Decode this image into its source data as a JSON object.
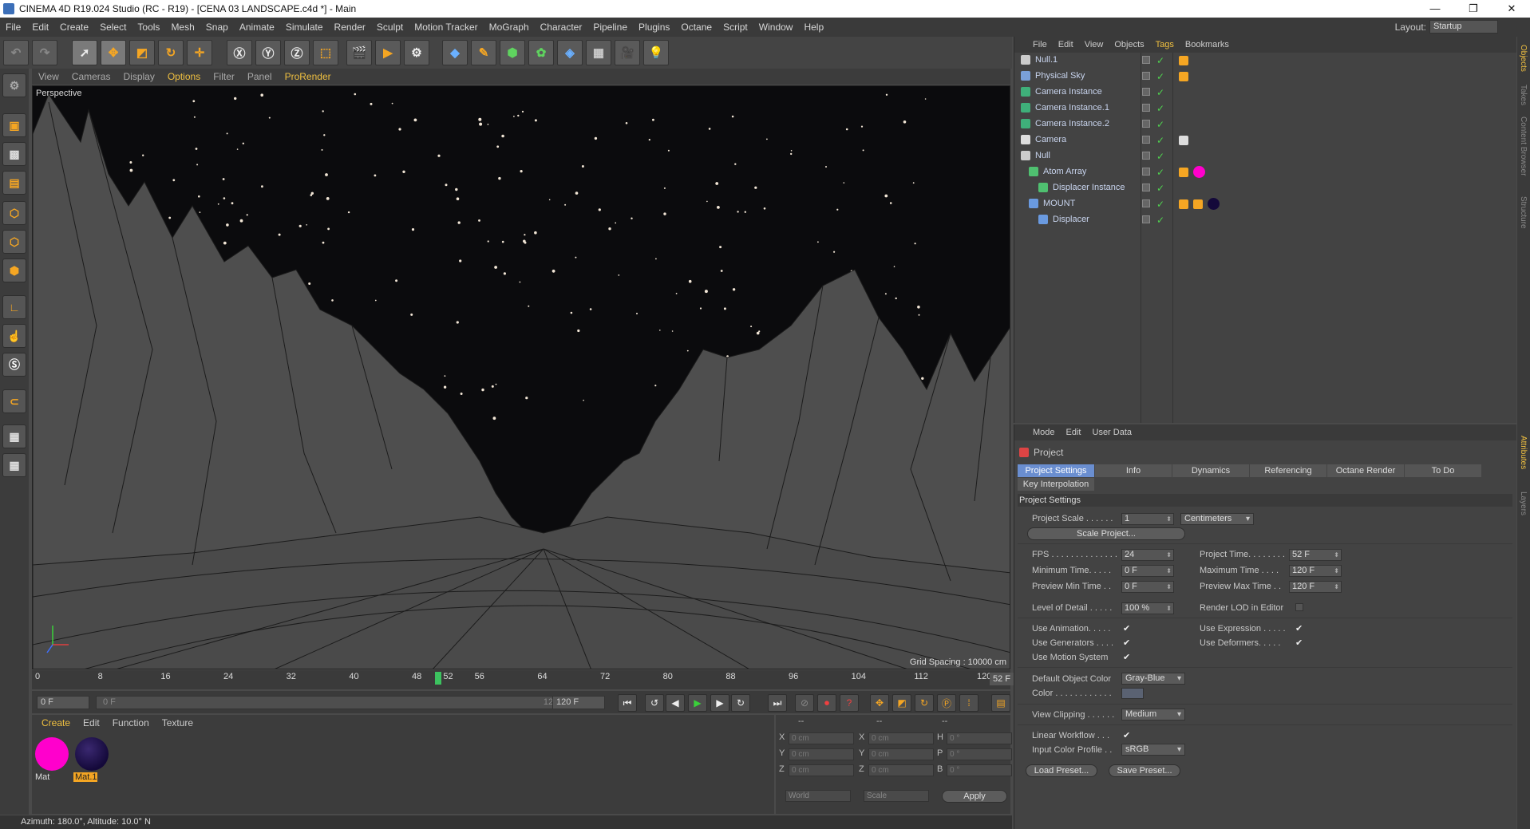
{
  "window": {
    "title": "CINEMA 4D R19.024 Studio (RC - R19) - [CENA 03 LANDSCAPE.c4d *] - Main"
  },
  "menu": [
    "File",
    "Edit",
    "Create",
    "Select",
    "Tools",
    "Mesh",
    "Snap",
    "Animate",
    "Simulate",
    "Render",
    "Sculpt",
    "Motion Tracker",
    "MoGraph",
    "Character",
    "Pipeline",
    "Plugins",
    "Octane",
    "Script",
    "Window",
    "Help"
  ],
  "layout": {
    "label": "Layout:",
    "value": "Startup"
  },
  "viewport": {
    "menu": [
      "View",
      "Cameras",
      "Display",
      "Options",
      "Filter",
      "Panel",
      "ProRender"
    ],
    "label": "Perspective",
    "grid_spacing": "Grid Spacing : 10000 cm"
  },
  "timeline": {
    "ticks": [
      "0",
      "8",
      "16",
      "24",
      "32",
      "40",
      "48",
      "52",
      "56",
      "64",
      "72",
      "80",
      "88",
      "96",
      "104",
      "112",
      "120"
    ],
    "current_frame": "52 F",
    "start": "0 F",
    "range_start": "0 F",
    "range_end": "120 F",
    "end": "120 F"
  },
  "materials": {
    "menu": [
      "Create",
      "Edit",
      "Function",
      "Texture"
    ],
    "items": [
      {
        "name": "Mat",
        "color": "#ff00cc"
      },
      {
        "name": "Mat.1",
        "color": "#14093a"
      }
    ]
  },
  "coords": {
    "headers": [
      "--",
      "--",
      "--"
    ],
    "rows": [
      {
        "a": "X",
        "av": "0 cm",
        "b": "X",
        "bv": "0 cm",
        "c": "H",
        "cv": "0 °"
      },
      {
        "a": "Y",
        "av": "0 cm",
        "b": "Y",
        "bv": "0 cm",
        "c": "P",
        "cv": "0 °"
      },
      {
        "a": "Z",
        "av": "0 cm",
        "b": "Z",
        "bv": "0 cm",
        "c": "B",
        "cv": "0 °"
      }
    ],
    "world": "World",
    "scale": "Scale",
    "apply": "Apply"
  },
  "status": "Azimuth: 180.0°, Altitude: 10.0°  N",
  "objects": {
    "menu": [
      "File",
      "Edit",
      "View",
      "Objects",
      "Tags",
      "Bookmarks"
    ],
    "rows": [
      {
        "name": "Null.1",
        "icon": "null-icon"
      },
      {
        "name": "Physical Sky",
        "icon": "sky-icon"
      },
      {
        "name": "Camera Instance",
        "icon": "camera-instance-icon"
      },
      {
        "name": "Camera Instance.1",
        "icon": "camera-instance-icon"
      },
      {
        "name": "Camera Instance.2",
        "icon": "camera-instance-icon"
      },
      {
        "name": "Camera",
        "icon": "camera-icon"
      },
      {
        "name": "Null",
        "icon": "null-icon"
      },
      {
        "name": "Atom Array",
        "icon": "atom-array-icon"
      },
      {
        "name": "Displacer Instance",
        "icon": "instance-icon"
      },
      {
        "name": "MOUNT",
        "icon": "plane-icon"
      },
      {
        "name": "Displacer",
        "icon": "displacer-icon"
      }
    ]
  },
  "attributes": {
    "menu": [
      "Mode",
      "Edit",
      "User Data"
    ],
    "object": "Project",
    "tabs": [
      "Project Settings",
      "Info",
      "Dynamics",
      "Referencing",
      "Octane Render",
      "To Do",
      "Key Interpolation"
    ],
    "section": "Project Settings",
    "project_scale": {
      "label": "Project Scale . . . . . .",
      "value": "1",
      "unit": "Centimeters"
    },
    "scale_project": "Scale Project...",
    "fps": {
      "label": "FPS . . . . . . . . . . . . . .",
      "value": "24"
    },
    "project_time": {
      "label": "Project Time. . . . . . . .",
      "value": "52 F"
    },
    "min_time": {
      "label": "Minimum Time. . . . .",
      "value": "0 F"
    },
    "max_time": {
      "label": "Maximum Time . . . .",
      "value": "120 F"
    },
    "preview_min": {
      "label": "Preview Min Time . .",
      "value": "0 F"
    },
    "preview_max": {
      "label": "Preview Max Time . .",
      "value": "120 F"
    },
    "lod": {
      "label": "Level of Detail . . . . .",
      "value": "100 %"
    },
    "render_lod": "Render LOD in Editor",
    "use_animation": "Use Animation. . . . .",
    "use_expression": "Use Expression . . . . .",
    "use_generators": "Use Generators . . . .",
    "use_deformers": "Use Deformers. . . . .",
    "use_motion": "Use Motion System",
    "default_color": {
      "label": "Default Object Color",
      "value": "Gray-Blue"
    },
    "color": {
      "label": "Color . . . . . . . . . . . .",
      "value": "#5a6272"
    },
    "view_clipping": {
      "label": "View Clipping . . . . . .",
      "value": "Medium"
    },
    "linear_workflow": "Linear Workflow . . .",
    "input_profile": {
      "label": "Input Color Profile . .",
      "value": "sRGB"
    },
    "load_preset": "Load Preset...",
    "save_preset": "Save Preset..."
  },
  "side_tabs": [
    "Objects",
    "Takes",
    "Content Browser",
    "Structure",
    "Attributes",
    "Layers"
  ]
}
